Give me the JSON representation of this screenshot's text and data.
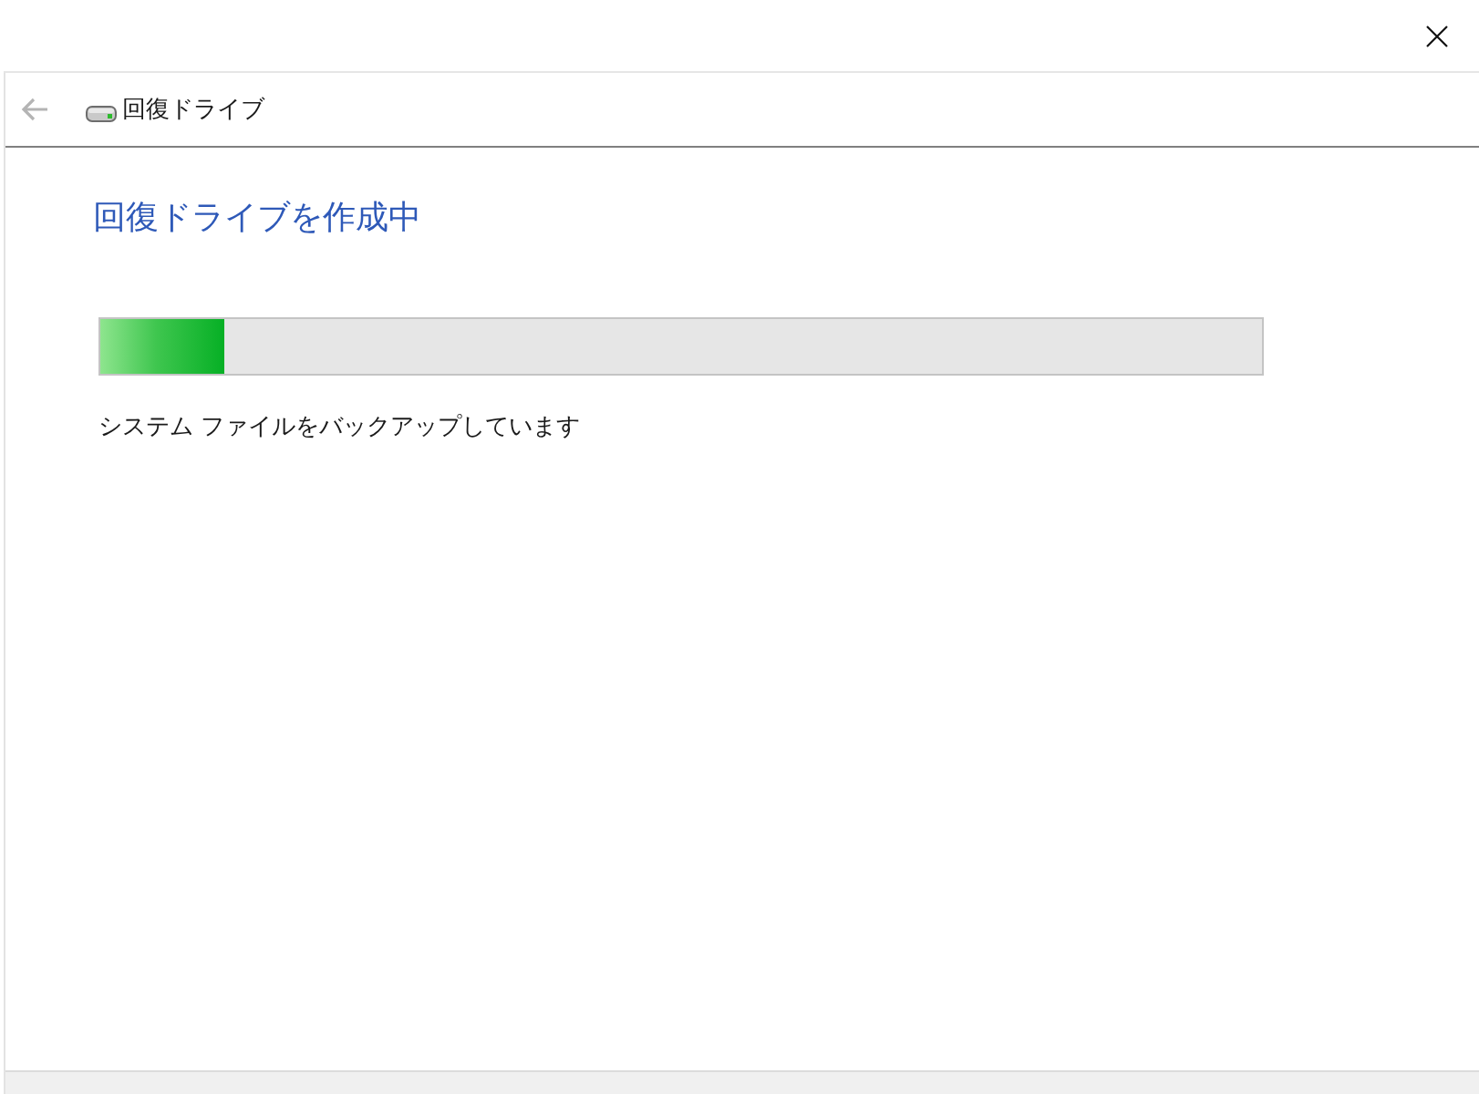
{
  "nav": {
    "back_button": {
      "disabled": true
    },
    "title": "回復ドライブ"
  },
  "heading": "回復ドライブを作成中",
  "progress": {
    "level": 0.107
  },
  "status": "システム ファイルをバックアップしています"
}
